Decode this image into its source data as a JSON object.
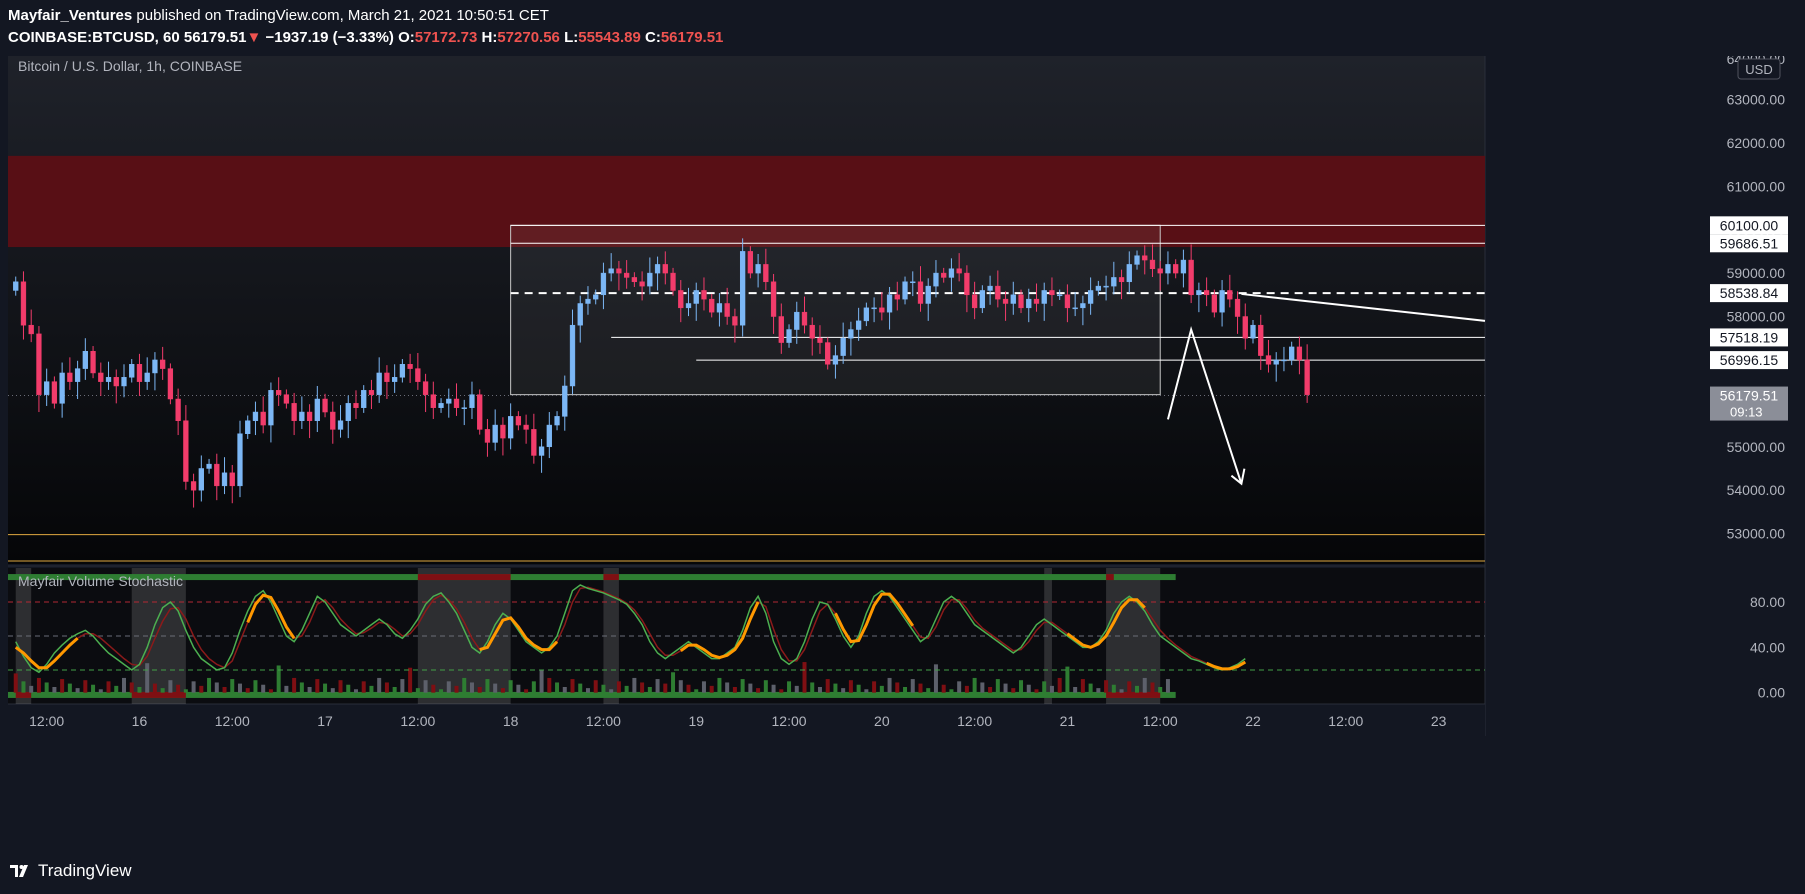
{
  "header": {
    "author": "Mayfair_Ventures",
    "published_text": "published on TradingView.com, March 21, 2021 10:50:51 CET",
    "symbol": "COINBASE:BTCUSD, 60",
    "last": "56179.51",
    "change_arrow": "▼",
    "change": "−1937.19 (−3.33%)",
    "o_label": "O:",
    "o_value": "57172.73",
    "h_label": "H:",
    "h_value": "57270.56",
    "l_label": "L:",
    "l_value": "55543.89",
    "c_label": "C:",
    "c_value": "56179.51"
  },
  "footer": {
    "brand": "TradingView"
  },
  "chart_data": [
    {
      "type": "candlestick",
      "title": "Bitcoin / U.S. Dollar, 1h, COINBASE",
      "currency_badge": "USD",
      "ylim": [
        52300,
        64000
      ],
      "y_ticks": [
        53000,
        54000,
        55000,
        56000,
        57000,
        58000,
        59000,
        60000,
        61000,
        62000,
        63000
      ],
      "y_tick_labels": [
        "53000.00",
        "54000.00",
        "55000.00",
        "56000.00",
        "57000.00",
        "58000.00",
        "59000.00",
        "60000.00",
        "61000.00",
        "62000.00",
        "63000.00"
      ],
      "top_partial_tick": "64000.00",
      "x_tick_labels": [
        "12:00",
        "16",
        "12:00",
        "17",
        "12:00",
        "18",
        "12:00",
        "19",
        "12:00",
        "20",
        "12:00",
        "21",
        "12:00",
        "22",
        "12:00",
        "23"
      ],
      "x_ticks_hours": [
        12,
        24,
        36,
        48,
        60,
        72,
        84,
        96,
        108,
        120,
        132,
        144,
        156,
        168,
        180,
        192
      ],
      "x_range_hours": [
        7,
        198
      ],
      "closes": [
        58800,
        57800,
        57600,
        56200,
        56500,
        56000,
        56700,
        56500,
        56800,
        57200,
        56700,
        56500,
        56600,
        56400,
        56600,
        56900,
        56500,
        56700,
        57000,
        56800,
        56100,
        55600,
        54200,
        54000,
        54500,
        54600,
        54100,
        54400,
        54100,
        55300,
        55600,
        55800,
        55500,
        56300,
        56200,
        56000,
        55600,
        55800,
        55600,
        56100,
        55800,
        55400,
        55600,
        56000,
        55900,
        56300,
        56200,
        56700,
        56500,
        56600,
        56900,
        56800,
        56500,
        56200,
        55900,
        56000,
        56100,
        55900,
        55900,
        56200,
        55400,
        55100,
        55500,
        55200,
        55700,
        55500,
        55400,
        54800,
        55000,
        55500,
        55700,
        56400,
        57800,
        58300,
        58400,
        58500,
        59000,
        59100,
        59000,
        58900,
        58800,
        58700,
        59000,
        59200,
        59000,
        58600,
        58200,
        58300,
        58600,
        58400,
        58100,
        58300,
        58000,
        57800,
        59500,
        59000,
        59200,
        58800,
        58000,
        57400,
        57700,
        58100,
        57800,
        57500,
        57400,
        56900,
        57100,
        57500,
        57700,
        57900,
        58200,
        58200,
        58100,
        58500,
        58400,
        58800,
        58800,
        58300,
        58700,
        59000,
        58900,
        59100,
        59000,
        58500,
        58200,
        58600,
        58700,
        58400,
        58300,
        58500,
        58200,
        58400,
        58300,
        58600,
        58500,
        58500,
        58200,
        58200,
        58300,
        58600,
        58700,
        58700,
        58900,
        58800,
        59200,
        59400,
        59300,
        59100,
        59000,
        59200,
        59000,
        59300,
        58500,
        58600,
        58500,
        58100,
        58600,
        58400,
        58000,
        57500,
        57800,
        57100,
        56900,
        57000,
        57000,
        57300,
        57000,
        56200
      ],
      "series_start_hour": 8,
      "levels": [
        {
          "label": "60100.00",
          "value": 60100,
          "style": "solid"
        },
        {
          "label": "59686.51",
          "value": 59686.51,
          "style": "solid"
        },
        {
          "label": "58538.84",
          "value": 58538.84,
          "style": "dashed"
        },
        {
          "label": "57518.19",
          "value": 57518.19,
          "style": "solid"
        },
        {
          "label": "56996.15",
          "value": 56996.15,
          "style": "solid"
        }
      ],
      "last_price_label": "56179.51",
      "countdown_label": "09:13",
      "supply_zone": [
        59600,
        61700
      ],
      "range_box": {
        "x_hours": [
          72,
          156
        ],
        "y": [
          56200,
          60100
        ]
      },
      "colors": {
        "up": "#7cb7f5",
        "down": "#f23c6b",
        "zone": "#580f15",
        "support_line": "#e0a840"
      }
    },
    {
      "type": "line",
      "title": "Mayfair Volume Stochastic",
      "ylim": [
        -10,
        110
      ],
      "y_tick_labels": [
        "0.00",
        "40.00",
        "80.00"
      ],
      "y_ticks": [
        0,
        40,
        80
      ],
      "levels": [
        20,
        50,
        80
      ],
      "series": [
        {
          "values": [
            45,
            32,
            22,
            18,
            25,
            35,
            42,
            48,
            52,
            55,
            50,
            42,
            35,
            30,
            25,
            20,
            25,
            40,
            60,
            75,
            80,
            72,
            55,
            40,
            30,
            25,
            20,
            22,
            35,
            55,
            72,
            85,
            90,
            80,
            65,
            50,
            45,
            55,
            70,
            85,
            80,
            70,
            60,
            55,
            50,
            55,
            60,
            65,
            60,
            52,
            48,
            55,
            65,
            78,
            85,
            88,
            80,
            70,
            55,
            40,
            35,
            45,
            60,
            70,
            65,
            55,
            45,
            40,
            35,
            40,
            50,
            70,
            90,
            95,
            92,
            90,
            88,
            85,
            82,
            78,
            70,
            60,
            45,
            35,
            30,
            35,
            40,
            45,
            40,
            35,
            30,
            30,
            35,
            40,
            55,
            75,
            85,
            70,
            45,
            30,
            25,
            30,
            45,
            65,
            80,
            78,
            65,
            50,
            40,
            50,
            70,
            85,
            90,
            85,
            75,
            65,
            55,
            45,
            50,
            65,
            80,
            85,
            80,
            70,
            60,
            55,
            50,
            45,
            40,
            35,
            40,
            50,
            60,
            65,
            60,
            55,
            50,
            45,
            40,
            40,
            45,
            55,
            70,
            80,
            85,
            80,
            72,
            60,
            50,
            45,
            40,
            35,
            30,
            28,
            25,
            22,
            20,
            22,
            25,
            30
          ]
        },
        {
          "values": [
            40,
            35,
            28,
            22,
            22,
            28,
            35,
            42,
            48,
            52,
            52,
            48,
            42,
            36,
            30,
            25,
            24,
            32,
            48,
            63,
            74,
            75,
            65,
            50,
            38,
            30,
            25,
            22,
            28,
            45,
            62,
            78,
            86,
            84,
            72,
            58,
            48,
            50,
            62,
            78,
            82,
            75,
            65,
            58,
            52,
            53,
            57,
            62,
            61,
            56,
            50,
            52,
            60,
            72,
            82,
            86,
            82,
            74,
            62,
            48,
            38,
            40,
            52,
            64,
            66,
            58,
            48,
            42,
            38,
            38,
            45,
            60,
            80,
            92,
            93,
            91,
            89,
            86,
            83,
            79,
            73,
            64,
            52,
            40,
            33,
            33,
            37,
            42,
            42,
            38,
            33,
            31,
            33,
            38,
            48,
            65,
            80,
            76,
            56,
            38,
            28,
            28,
            38,
            55,
            72,
            78,
            70,
            56,
            45,
            46,
            60,
            77,
            87,
            87,
            79,
            69,
            59,
            49,
            48,
            58,
            73,
            82,
            82,
            74,
            64,
            57,
            52,
            47,
            42,
            37,
            38,
            45,
            55,
            62,
            62,
            57,
            52,
            47,
            42,
            40,
            43,
            50,
            62,
            75,
            82,
            82,
            75,
            65,
            55,
            48,
            42,
            37,
            32,
            29,
            26,
            23,
            21,
            21,
            23,
            27
          ]
        }
      ],
      "orange_segments": [
        [
          0,
          8
        ],
        [
          30,
          36
        ],
        [
          60,
          70
        ],
        [
          86,
          96
        ],
        [
          106,
          116
        ],
        [
          136,
          146
        ],
        [
          154,
          160
        ]
      ],
      "regime_bar_colors": {
        "bull": "#2e7d32",
        "bear": "#7f0f13"
      },
      "shaded_windows_hours": [
        [
          8,
          10
        ],
        [
          23,
          30
        ],
        [
          60,
          72
        ],
        [
          84,
          86
        ],
        [
          141,
          142
        ],
        [
          149,
          156
        ]
      ]
    }
  ]
}
